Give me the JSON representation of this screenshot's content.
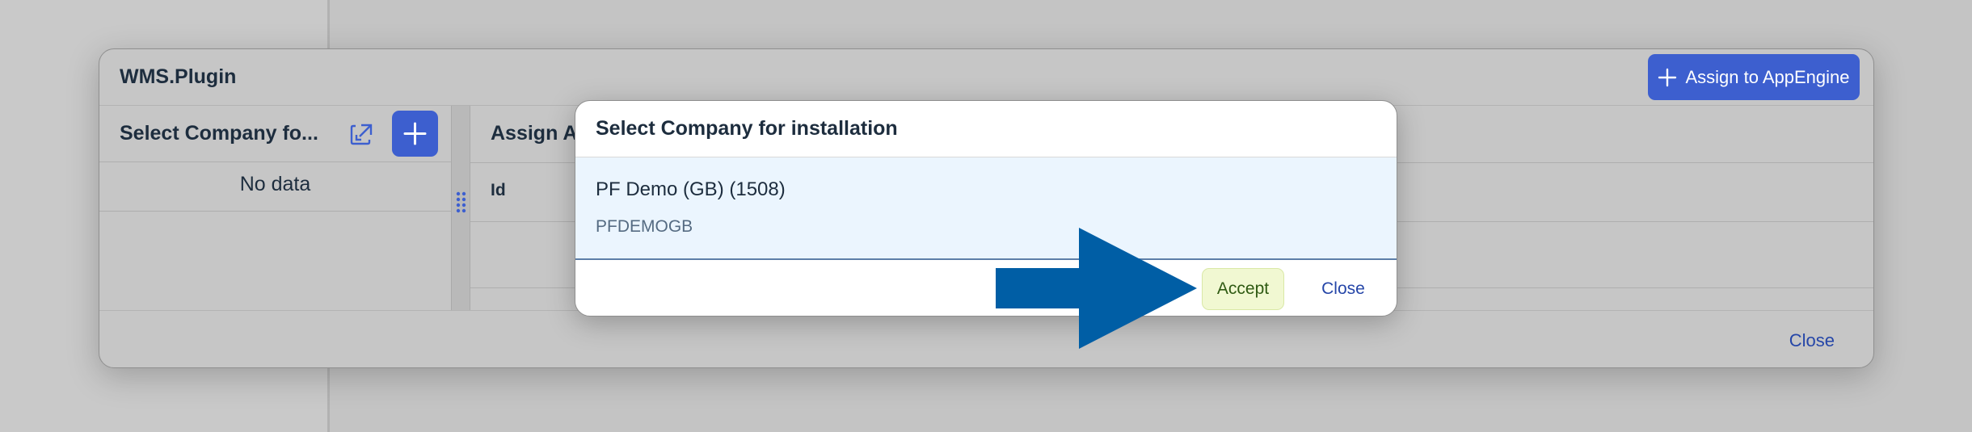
{
  "outer_dialog": {
    "title": "WMS.Plugin",
    "left_panel": {
      "title": "Select Company fo...",
      "empty_text": "No data"
    },
    "right_panel": {
      "title": "Assign A",
      "assign_button_label": "Assign to AppEngine",
      "columns": [
        "Id"
      ]
    },
    "close_label": "Close"
  },
  "inner_dialog": {
    "title": "Select Company for installation",
    "items": [
      {
        "title": "PF Demo (GB) (1508)",
        "description": "PFDEMOGB"
      }
    ],
    "accept_label": "Accept",
    "close_label": "Close"
  },
  "colors": {
    "primary": "#3d5fcf",
    "accept_bg": "#f1f8d2",
    "accept_text": "#2f5a13",
    "link": "#2546a8",
    "arrow": "#005ea5",
    "selected_bg": "#ebf5fe"
  },
  "icons": [
    "open-external-icon",
    "plus-icon",
    "grip-icon",
    "arrow-pointer-icon"
  ]
}
